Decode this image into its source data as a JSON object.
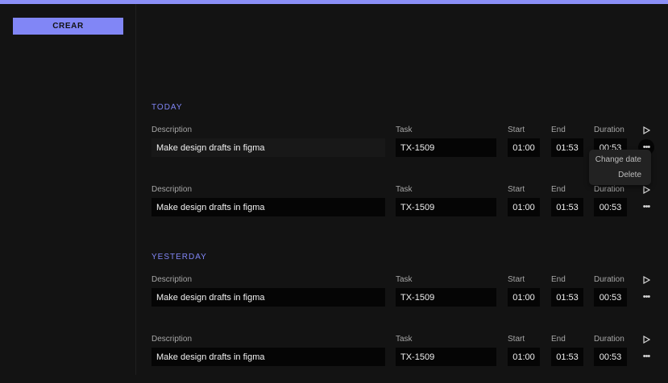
{
  "sidebar": {
    "create_label": "CREAR"
  },
  "sections": [
    {
      "title": "TODAY"
    },
    {
      "title": "YESTERDAY"
    }
  ],
  "labels": {
    "description": "Description",
    "task": "Task",
    "start": "Start",
    "end": "End",
    "duration": "Duration"
  },
  "entries": [
    {
      "description": "Make design drafts in figma",
      "task": "TX-1509",
      "start": "01:00",
      "end": "01:53",
      "duration": "00:53"
    },
    {
      "description": "Make design drafts in figma",
      "task": "TX-1509",
      "start": "01:00",
      "end": "01:53",
      "duration": "00:53"
    },
    {
      "description": "Make design drafts in figma",
      "task": "TX-1509",
      "start": "01:00",
      "end": "01:53",
      "duration": "00:53"
    },
    {
      "description": "Make design drafts in figma",
      "task": "TX-1509",
      "start": "01:00",
      "end": "01:53",
      "duration": "00:53"
    }
  ],
  "context_menu": {
    "items": [
      "Change date",
      "Delete"
    ]
  },
  "icons": {
    "play": "play-icon",
    "more": "more-horizontal-icon"
  },
  "colors": {
    "accent": "#8186f6",
    "background": "#131313",
    "field": "#050505"
  }
}
